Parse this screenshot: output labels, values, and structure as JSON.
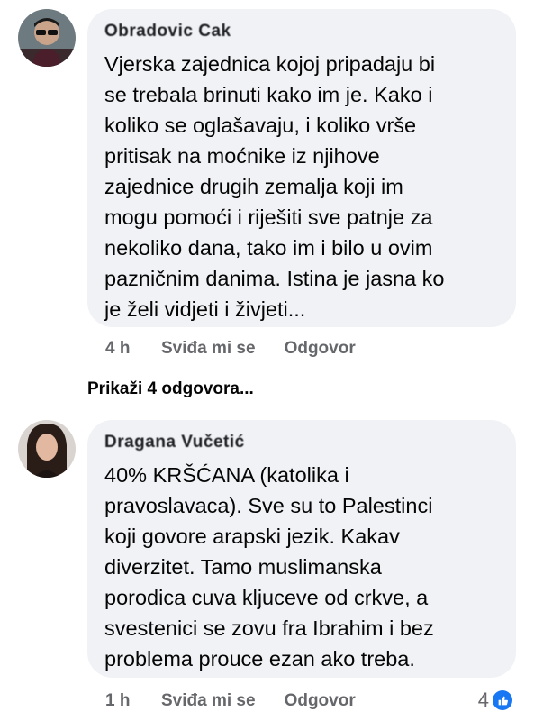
{
  "comments": [
    {
      "author": "Obradovic Cak",
      "text": "Vjerska zajednica kojoj pripadaju bi\nse trebala brinuti kako im je. Kako i\nkoliko se oglašavaju, i koliko vrše\npritisak na moćnike iz njihove\nzajednice drugih zemalja koji im\nmogu pomoći i riješiti sve patnje za\nnekoliko dana, tako im i bilo u ovim\npazničnim danima. Istina je jasna ko\nje želi vidjeti i živjeti...",
      "time": "4 h",
      "like_label": "Sviđa mi se",
      "reply_label": "Odgovor",
      "view_replies": "Prikaži 4 odgovora..."
    },
    {
      "author": "Dragana Vučetić",
      "text": "40% KRŠĆANA (katolika i\npravoslavaca). Sve su to Palestinci\nkoji govore arapski jezik. Kakav\ndiverzitet. Tamo muslimanska\nporodica cuva kljuceve od crkve, a\nsvestenici se zovu fra Ibrahim i bez\nproblema prouce ezan ako treba.",
      "time": "1 h",
      "like_label": "Sviđa mi se",
      "reply_label": "Odgovor",
      "reaction_count": "4",
      "reaction_icon": "like-icon",
      "reaction_color": "#1877f2"
    }
  ]
}
